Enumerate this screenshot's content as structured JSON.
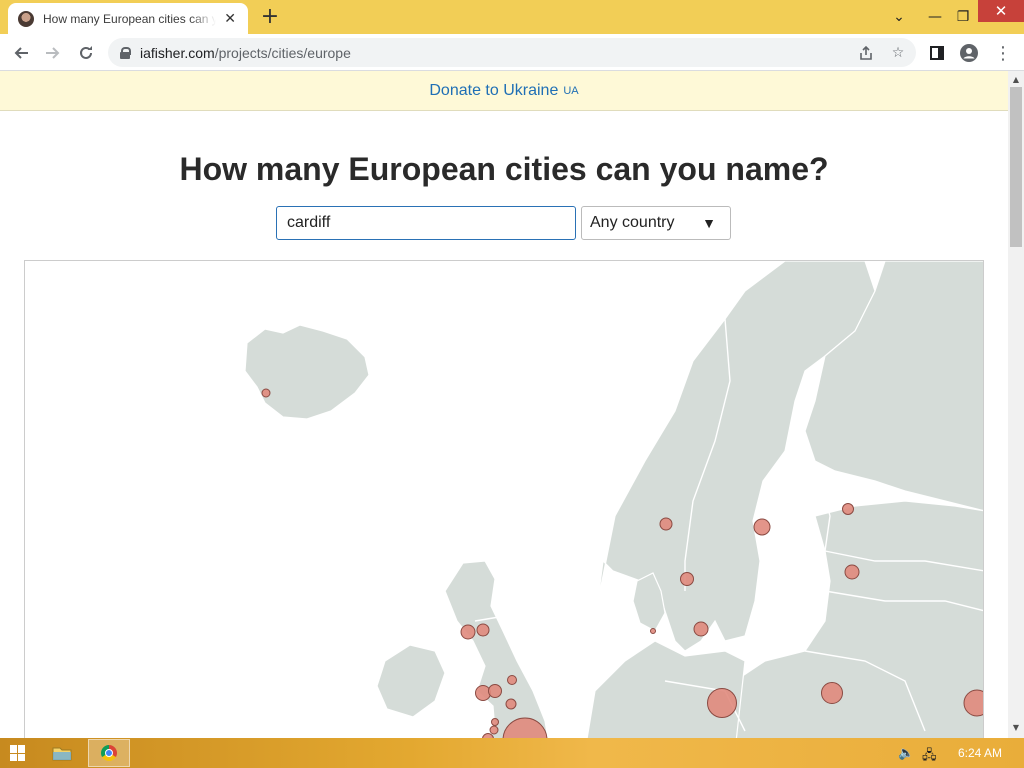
{
  "browser": {
    "tab_title": "How many European cities can you name?",
    "tab_close": "✕",
    "new_tab": "+",
    "url_host": "iafisher.com",
    "url_path": "/projects/cities/europe",
    "icons": [
      "back-icon",
      "forward-icon",
      "reload-icon",
      "lock-icon",
      "share-icon",
      "bookmark-star-icon",
      "side-panel-icon",
      "profile-icon",
      "menu-icon",
      "tab-search-icon"
    ]
  },
  "banner": {
    "donate_label": "Donate to Ukraine",
    "flag_label": "UA"
  },
  "quiz": {
    "title": "How many European cities can you name?",
    "input_value": "cardiff",
    "country_select": "Any country"
  },
  "map": {
    "land_color": "#d5dcd8",
    "border_color": "#ffffff",
    "city_marker_color": "#e08a7d",
    "city_marker_stroke": "#8a4a42",
    "visible_regions": [
      "Iceland",
      "Ireland",
      "Great Britain",
      "Norway",
      "Sweden",
      "Finland",
      "Denmark",
      "Estonia",
      "Latvia",
      "Lithuania",
      "Poland",
      "Germany",
      "Netherlands"
    ]
  },
  "taskbar": {
    "clock": "6:24 AM",
    "accent": "#e3a830"
  }
}
